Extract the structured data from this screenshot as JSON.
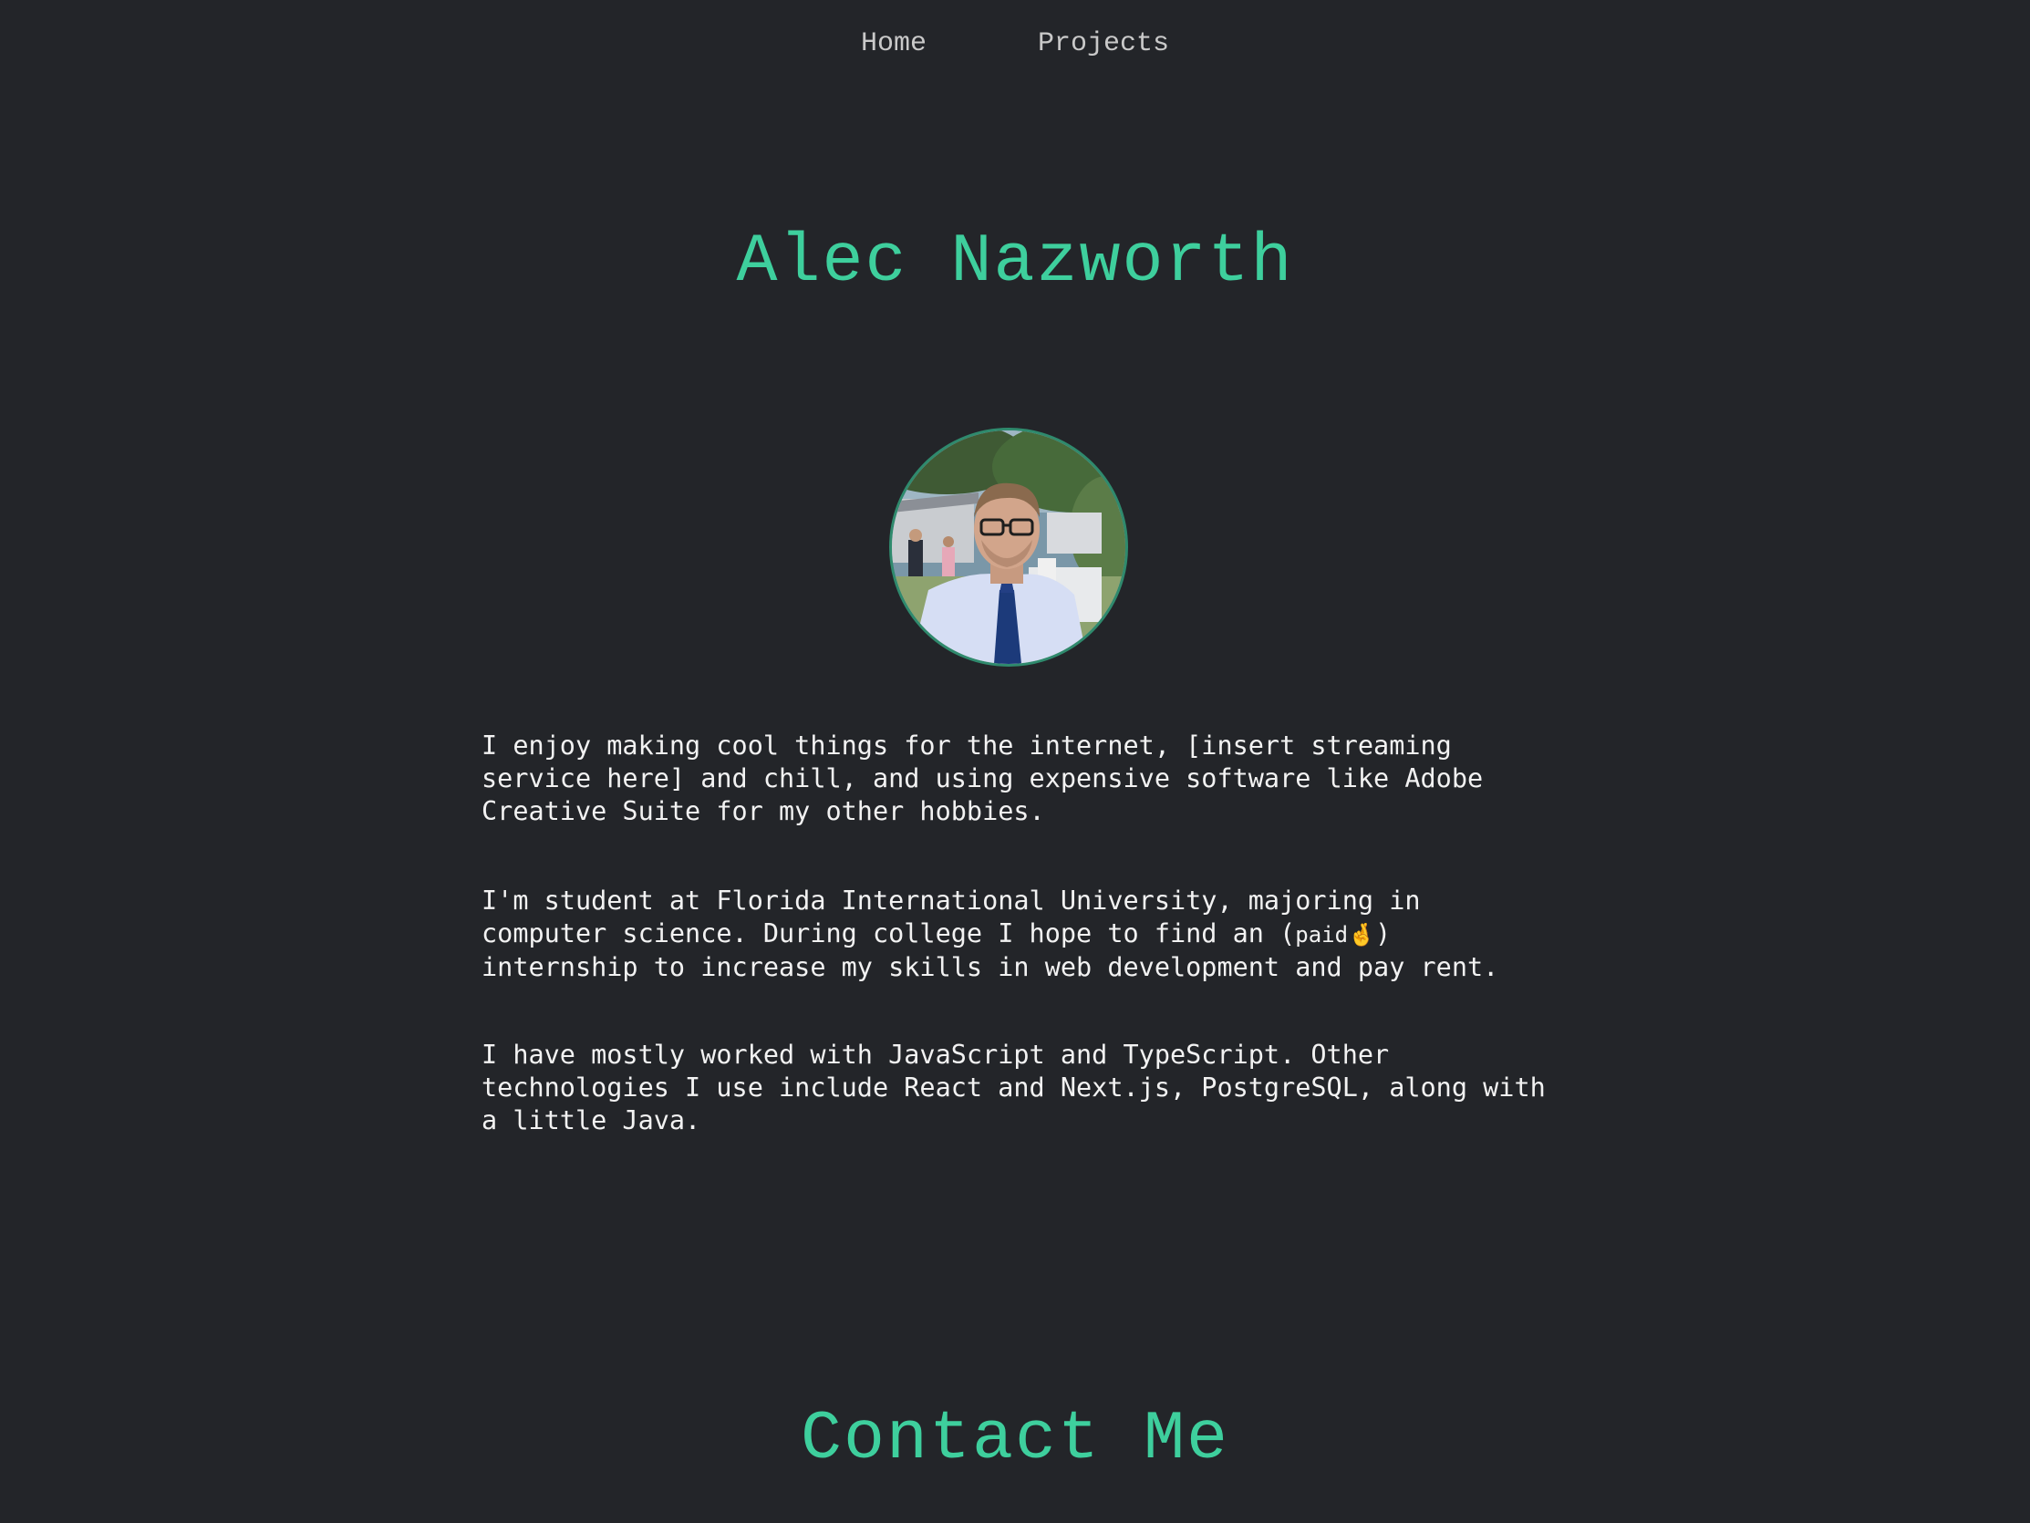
{
  "nav": {
    "items": [
      {
        "label": "Home"
      },
      {
        "label": "Projects"
      }
    ]
  },
  "hero": {
    "name": "Alec Nazworth",
    "avatar_alt": "profile photo"
  },
  "bio": {
    "paragraph1": "I enjoy making cool things for the internet, [insert streaming\nservice here] and chill, and using expensive software like Adobe\nCreative Suite for my other hobbies.",
    "paragraph2_before": "I'm student at Florida International University, majoring in\ncomputer science. During college I hope to find an (",
    "paragraph2_paid": "paid",
    "paragraph2_emoji": "🤞",
    "paragraph2_after": ")\ninternship to increase my skills in web development and pay rent.",
    "paragraph3": "I have mostly worked with JavaScript and TypeScript. Other\ntechnologies I use include React and Next.js, PostgreSQL, along with\na little Java."
  },
  "contact": {
    "heading": "Contact Me"
  },
  "colors": {
    "background": "#232529",
    "accent": "#3ecf9d",
    "nav_text": "#c9c9c9",
    "body_text": "#f2f2f2"
  }
}
